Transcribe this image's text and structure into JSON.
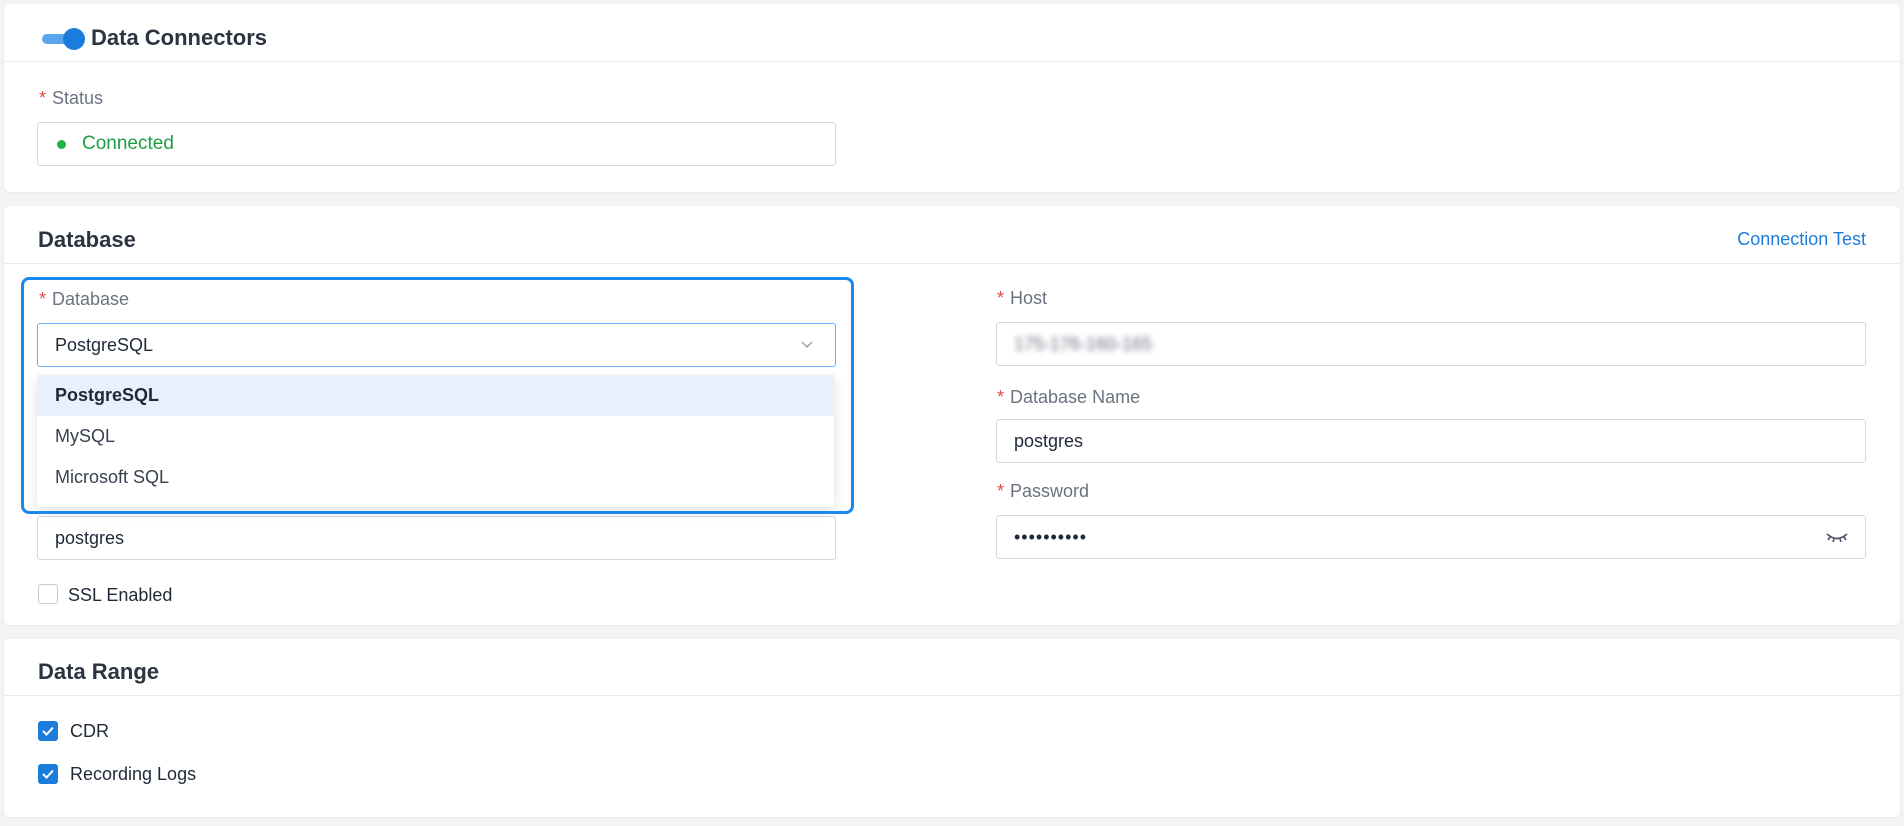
{
  "connector": {
    "title": "Data Connectors",
    "toggle_on": true,
    "status_label": "Status",
    "status_value": "Connected",
    "status_color": "#1d9e45"
  },
  "database_section": {
    "title": "Database",
    "connection_test": "Connection Test",
    "database_label": "Database",
    "database_value": "PostgreSQL",
    "options": [
      "PostgreSQL",
      "MySQL",
      "Microsoft SQL"
    ],
    "selected_option": "PostgreSQL",
    "username_value": "postgres",
    "ssl_label": "SSL Enabled",
    "ssl_checked": false,
    "host_label": "Host",
    "host_value": "175-176-160-165",
    "dbname_label": "Database Name",
    "dbname_value": "postgres",
    "password_label": "Password",
    "password_value": "••••••••••"
  },
  "data_range": {
    "title": "Data Range",
    "items": [
      {
        "label": "CDR",
        "checked": true
      },
      {
        "label": "Recording Logs",
        "checked": true
      }
    ]
  },
  "colors": {
    "accent": "#1a7ddb",
    "required": "#e24a3b",
    "focus_ring": "#1a88f0"
  },
  "icons": {
    "toggle": "toggle-switch-icon",
    "status": "status-dot-icon",
    "dropdown": "chevron-down-icon",
    "password": "eye-closed-icon",
    "checkbox": "checkmark-icon"
  }
}
